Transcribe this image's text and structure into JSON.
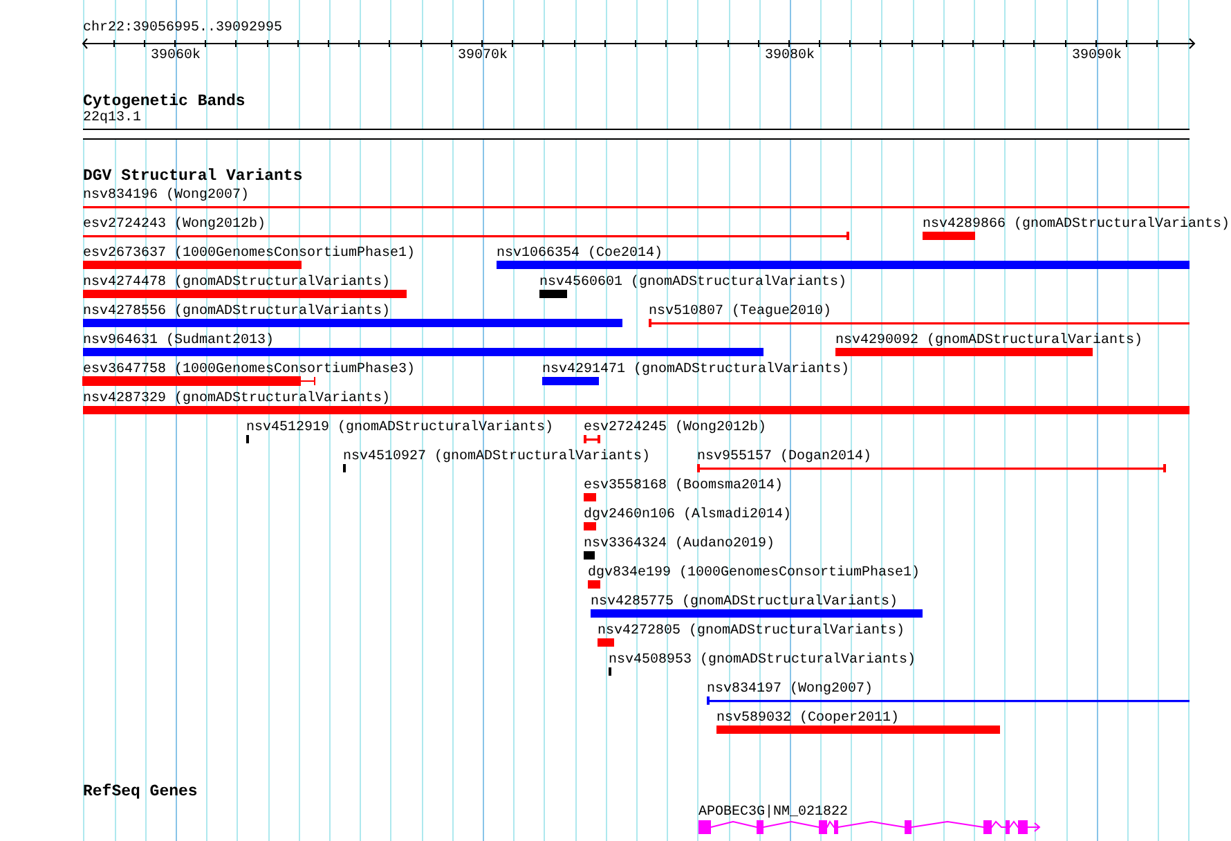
{
  "ruler": {
    "position": "chr22:39056995..39092995",
    "ticks": [
      "39060k",
      "39070k",
      "39080k",
      "39090k"
    ]
  },
  "tracks": [
    {
      "kind": "bands",
      "title": "Cytogenetic Bands",
      "features": [
        {
          "label": "22q13.1"
        }
      ]
    },
    {
      "kind": "variants",
      "title": "DGV Structural Variants",
      "features": [
        {
          "label": "nsv834196 (Wong2007)",
          "kind": "line",
          "color": "#ff0000"
        },
        {
          "label": "esv2724243 (Wong2012b)",
          "kind": "line",
          "color": "#ff0000"
        },
        {
          "label": "nsv4289866 (gnomADStructuralVariants)",
          "kind": "bar",
          "color": "#ff0000"
        },
        {
          "label": "esv2673637 (1000GenomesConsortiumPhase1)",
          "kind": "bar",
          "color": "#ff0000"
        },
        {
          "label": "nsv1066354 (Coe2014)",
          "kind": "bar",
          "color": "#0000ff"
        },
        {
          "label": "nsv4274478 (gnomADStructuralVariants)",
          "kind": "bar",
          "color": "#ff0000"
        },
        {
          "label": "nsv4560601 (gnomADStructuralVariants)",
          "kind": "bar",
          "color": "#000000"
        },
        {
          "label": "nsv4278556 (gnomADStructuralVariants)",
          "kind": "bar",
          "color": "#0000ff"
        },
        {
          "label": "nsv510807 (Teague2010)",
          "kind": "line",
          "color": "#ff0000"
        },
        {
          "label": "nsv964631 (Sudmant2013)",
          "kind": "bar",
          "color": "#0000ff"
        },
        {
          "label": "nsv4290092 (gnomADStructuralVariants)",
          "kind": "bar",
          "color": "#ff0000"
        },
        {
          "label": "esv3647758 (1000GenomesConsortiumPhase3)",
          "kind": "bar",
          "color": "#ff0000"
        },
        {
          "label": "nsv4291471 (gnomADStructuralVariants)",
          "kind": "bar",
          "color": "#0000ff"
        },
        {
          "label": "nsv4287329 (gnomADStructuralVariants)",
          "kind": "bar",
          "color": "#ff0000"
        },
        {
          "label": "nsv4512919 (gnomADStructuralVariants)",
          "kind": "bar",
          "color": "#000000"
        },
        {
          "label": "esv2724245 (Wong2012b)",
          "kind": "line",
          "color": "#ff0000"
        },
        {
          "label": "nsv4510927 (gnomADStructuralVariants)",
          "kind": "bar",
          "color": "#000000"
        },
        {
          "label": "nsv955157 (Dogan2014)",
          "kind": "line",
          "color": "#ff0000"
        },
        {
          "label": "esv3558168 (Boomsma2014)",
          "kind": "bar",
          "color": "#ff0000"
        },
        {
          "label": "dgv2460n106 (Alsmadi2014)",
          "kind": "bar",
          "color": "#ff0000"
        },
        {
          "label": "nsv3364324 (Audano2019)",
          "kind": "bar",
          "color": "#000000"
        },
        {
          "label": "dgv834e199 (1000GenomesConsortiumPhase1)",
          "kind": "bar",
          "color": "#ff0000"
        },
        {
          "label": "nsv4285775 (gnomADStructuralVariants)",
          "kind": "bar",
          "color": "#0000ff"
        },
        {
          "label": "nsv4272805 (gnomADStructuralVariants)",
          "kind": "bar",
          "color": "#ff0000"
        },
        {
          "label": "nsv4508953 (gnomADStructuralVariants)",
          "kind": "bar",
          "color": "#000000"
        },
        {
          "label": "nsv834197 (Wong2007)",
          "kind": "line",
          "color": "#0000ff"
        },
        {
          "label": "nsv589032 (Cooper2011)",
          "kind": "bar",
          "color": "#ff0000"
        }
      ]
    },
    {
      "kind": "genes",
      "title": "RefSeq Genes",
      "features": [
        {
          "label": "APOBEC3G|NM_021822",
          "color": "#ff00ff"
        }
      ]
    }
  ]
}
